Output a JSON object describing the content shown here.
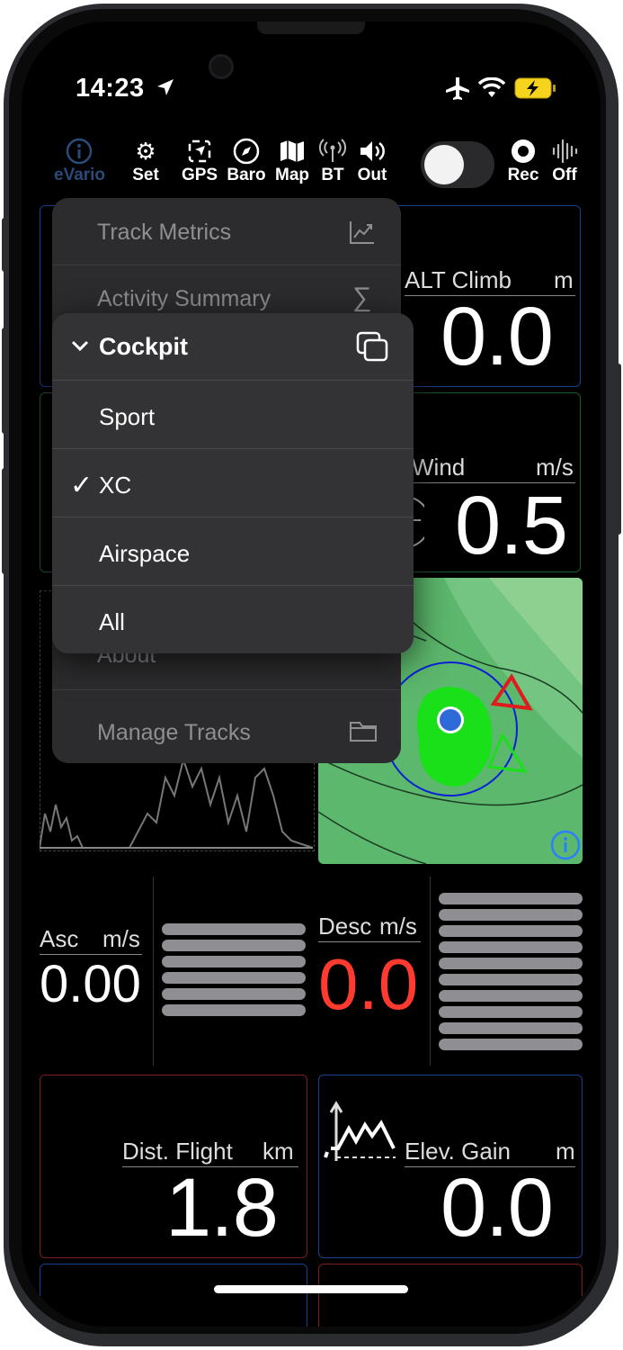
{
  "status": {
    "time": "14:23"
  },
  "toolbar": {
    "items": [
      {
        "label": "eVario",
        "icon": "info-icon"
      },
      {
        "label": "Set",
        "icon": "gear-icon"
      },
      {
        "label": "GPS",
        "icon": "gps-icon"
      },
      {
        "label": "Baro",
        "icon": "compass-icon"
      },
      {
        "label": "Map",
        "icon": "map-icon"
      },
      {
        "label": "BT",
        "icon": "antenna-icon"
      },
      {
        "label": "Out",
        "icon": "speaker-icon"
      },
      {
        "label": "Rec",
        "icon": "record-icon"
      },
      {
        "label": "Off",
        "icon": "waveform-icon"
      }
    ]
  },
  "panels": {
    "alt_climb": {
      "label": "ALT Climb",
      "unit": "m",
      "value": "0.0"
    },
    "wind": {
      "label": "Wind",
      "unit": "m/s",
      "value": "0.5"
    },
    "asc": {
      "label": "Asc",
      "unit": "m/s",
      "value": "0.00"
    },
    "desc": {
      "label": "Desc",
      "unit": "m/s",
      "value": "0.0"
    },
    "dist_flight": {
      "label": "Dist. Flight",
      "unit": "km",
      "value": "1.8"
    },
    "elev_gain": {
      "label": "Elev. Gain",
      "unit": "m",
      "value": "0.0"
    }
  },
  "back_menu": {
    "items": [
      "Track Metrics",
      "Activity Summary",
      "About",
      "Manage Tracks"
    ]
  },
  "front_menu": {
    "header": "Cockpit",
    "items": [
      {
        "label": "Sport",
        "checked": false
      },
      {
        "label": "XC",
        "checked": true
      },
      {
        "label": "Airspace",
        "checked": false
      },
      {
        "label": "All",
        "checked": false
      }
    ],
    "check_mark": "✓",
    "chevron": "⌄"
  },
  "colors": {
    "accent_blue": "#2a7fff",
    "alert_red": "#ff3b30",
    "map_green": "#5cb86c"
  }
}
